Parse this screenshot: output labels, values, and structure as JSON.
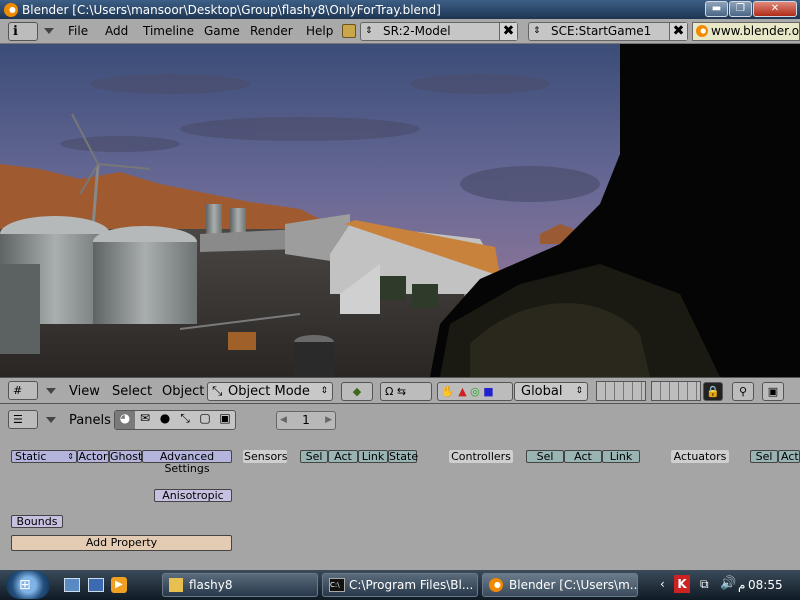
{
  "window": {
    "title": "Blender [C:\\Users\\mansoor\\Desktop\\Group\\flashy8\\OnlyForTray.blend]",
    "minimize_label": "▬",
    "maximize_label": "❐",
    "close_label": "✕"
  },
  "header": {
    "menus": [
      "File",
      "Add",
      "Timeline",
      "Game",
      "Render",
      "Help"
    ],
    "screen_field": "SR:2-Model",
    "scene_field": "SCE:StartGame1",
    "url_text": "www.blender.or",
    "close_label": "✖"
  },
  "view3d_header": {
    "menus": [
      "View",
      "Select",
      "Object"
    ],
    "mode": "Object Mode",
    "orientation": "Global"
  },
  "buttons_header": {
    "panels_label": "Panels",
    "frame": "1"
  },
  "logic": {
    "physics_type": "Static",
    "actor": "Actor",
    "ghost": "Ghost",
    "advanced": "Advanced Settings",
    "anisotropic": "Anisotropic",
    "bounds": "Bounds",
    "add_property": "Add Property",
    "sensors": "Sensors",
    "controllers": "Controllers",
    "actuators": "Actuators",
    "sensor_buttons": [
      "Sel",
      "Act",
      "Link",
      "State"
    ],
    "controller_buttons": [
      "Sel",
      "Act",
      "Link"
    ],
    "actuator_buttons": [
      "Sel",
      "Act"
    ]
  },
  "taskbar": {
    "tasks": [
      "flashy8",
      "C:\\Program Files\\Bl...",
      "Blender [C:\\Users\\m..."
    ],
    "clock": "08:55",
    "clock_suffix": "م"
  },
  "colors": {
    "blender_orange": "#f08a00",
    "panel_gray": "#a5a5a5",
    "add_property_bg": "#e4ccb4"
  }
}
